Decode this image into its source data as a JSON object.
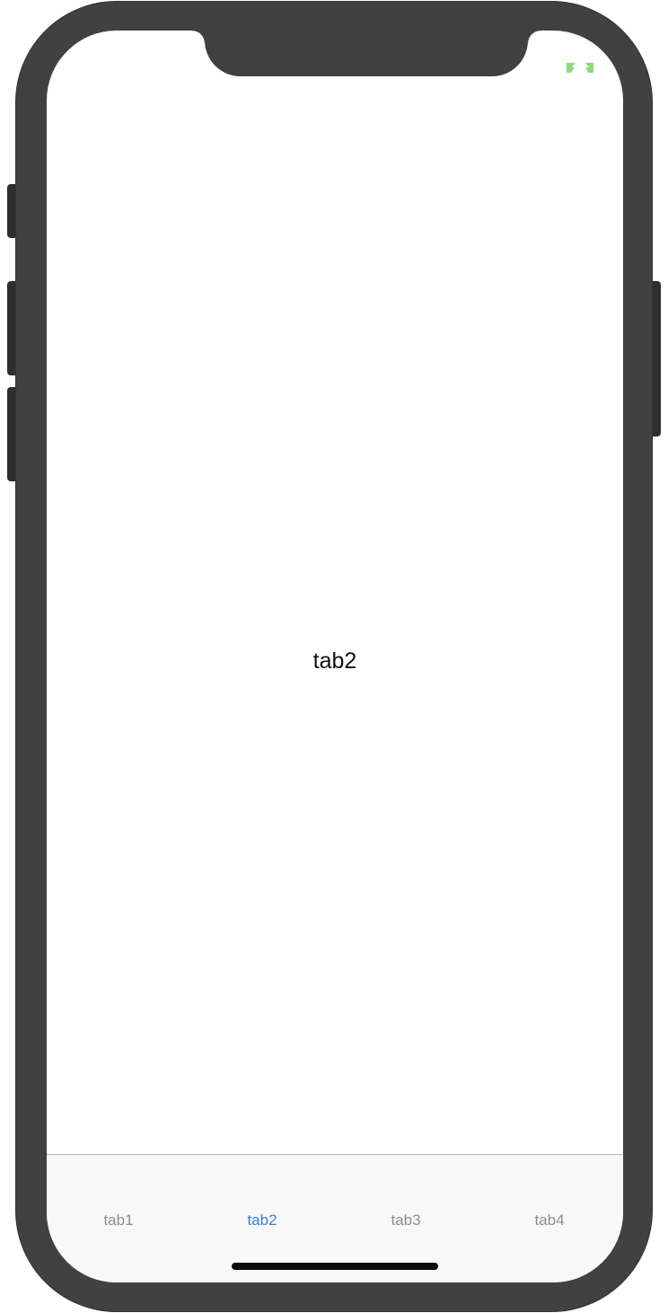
{
  "device": {
    "frame_color": "#414141",
    "screen_color": "#ffffff"
  },
  "status_bar": {
    "indicator_icon": "battery-charging-icon",
    "indicator_color": "#8fd97c"
  },
  "main": {
    "title": "tab2"
  },
  "tabbar": {
    "active_color": "#3a7dde",
    "inactive_color": "#8e8e8e",
    "background": "#f8f8f8",
    "items": [
      {
        "label": "tab1",
        "active": false
      },
      {
        "label": "tab2",
        "active": true
      },
      {
        "label": "tab3",
        "active": false
      },
      {
        "label": "tab4",
        "active": false
      }
    ]
  }
}
